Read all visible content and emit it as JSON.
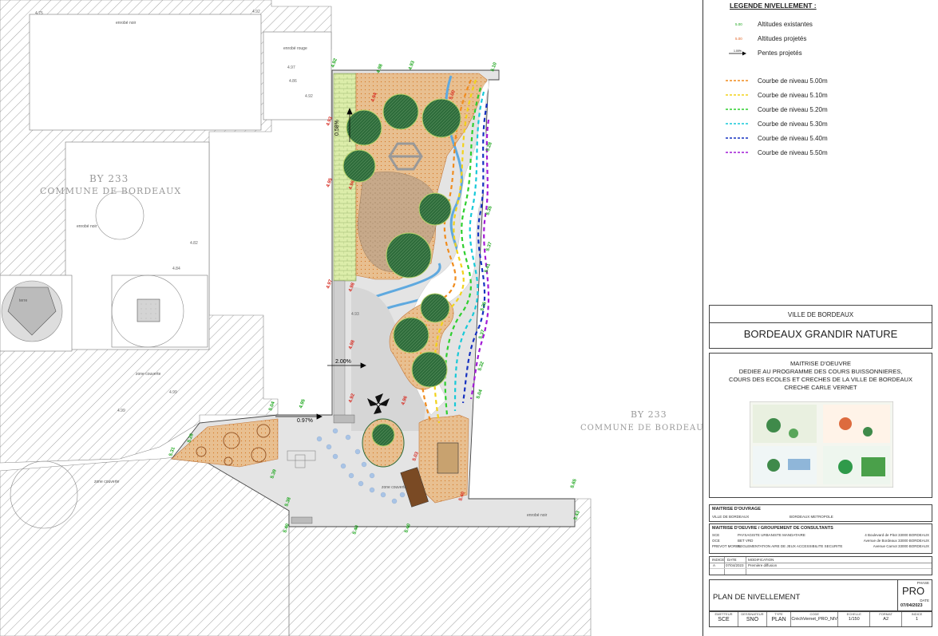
{
  "plan": {
    "parcel_left": {
      "line1": "BY 233",
      "line2": "COMMUNE DE BORDEAUX"
    },
    "parcel_right": {
      "line1": "BY 233",
      "line2": "COMMUNE DE BORDEAU"
    },
    "slopes": [
      "0.58%",
      "2.00%",
      "0.97%"
    ],
    "small_labels": [
      "terre",
      "zone couverte",
      "zone couverte",
      "zone couverte",
      "enrobé noir",
      "enrobé rouge",
      "enrobé noir",
      "enrobé noir"
    ],
    "altitudes_existing": [
      "4.92",
      "4.98",
      "4.93",
      "5.10",
      "5.04",
      "4.95",
      "5.31",
      "5.26",
      "5.39",
      "5.38",
      "5.40",
      "5.40",
      "5.40",
      "5.65",
      "5.43",
      "5.28",
      "5.35",
      "5.37",
      "5.41",
      "5.35",
      "5.37",
      "5.32",
      "5.04"
    ],
    "altitudes_projected": [
      "4.93",
      "4.95",
      "4.97",
      "4.98",
      "4.98",
      "4.94",
      "4.92",
      "4.96",
      "4.96",
      "5.00",
      "5.40",
      "5.03"
    ],
    "grey_labels": [
      "4.75",
      "4.92",
      "4.97",
      "4.86",
      "4.92",
      "4.82",
      "4.84",
      "4.99",
      "4.99",
      "4.93"
    ]
  },
  "legend": {
    "title": "LEGENDE NIVELLEMENT :",
    "items": [
      {
        "label": "Altitudes existantes",
        "symbol_text": "5.00",
        "color": "#1aa51a",
        "kind": "text"
      },
      {
        "label": "Altitudes projetés",
        "symbol_text": "5.00",
        "color": "#e06020",
        "kind": "text"
      },
      {
        "label": "Pentes projetés",
        "symbol_text": "1.00%",
        "color": "#000000",
        "kind": "arrow"
      },
      {
        "label": "Courbe de niveau 5.00m",
        "color": "#f08c1e",
        "kind": "dash"
      },
      {
        "label": "Courbe de niveau 5.10m",
        "color": "#f2d21a",
        "kind": "dash"
      },
      {
        "label": "Courbe de niveau 5.20m",
        "color": "#2fcf2f",
        "kind": "dash"
      },
      {
        "label": "Courbe de niveau 5.30m",
        "color": "#17c9d8",
        "kind": "dash"
      },
      {
        "label": "Courbe de niveau 5.40m",
        "color": "#1530c0",
        "kind": "dash"
      },
      {
        "label": "Courbe de niveau 5.50m",
        "color": "#a21ad6",
        "kind": "dash"
      }
    ]
  },
  "cartouche": {
    "city": "VILLE DE BORDEAUX",
    "project": "BORDEAUX GRANDIR NATURE",
    "moe_lines": [
      "MAITRISE D'OEUVRE",
      "DEDIEE AU PROGRAMME DES COURS BUISSONNIERES,",
      "COURS DES ECOLES ET CRECHES DE LA VILLE DE BORDEAUX",
      "CRECHE CARLE VERNET"
    ],
    "moa_title": "MAITRISE D'OUVRAGE",
    "moa_left": "VILLE DE BORDEAUX",
    "moa_right": "BORDEAUX METROPOLE",
    "group_title": "MAITRISE D'OEUVRE / GROUPEMENT DE CONSULTANTS",
    "consultants": [
      {
        "code": "SCE",
        "name": "PAYSAGISTE URBANISTE MANDATAIRE",
        "addr": "4 Boulevard de Pitot 33000 BORDEAUX"
      },
      {
        "code": "OCE",
        "name": "BET VRD",
        "addr": "Avenue de Bordeaux 33000 BORDEAUX"
      },
      {
        "code": "PREVOT MOREL",
        "name": "REGLEMENTATION AIRE DE JEUX ACCESSIBILITE SECURITE",
        "addr": "Avenue Carnot 33000 BORDEAUX"
      }
    ],
    "index_headers": [
      "INDICE",
      "DATE",
      "MODIFICATION"
    ],
    "index_rows": [
      [
        "A",
        "07/04/2023",
        "Première diffusion"
      ]
    ],
    "drawing_title": "PLAN DE NIVELLEMENT",
    "phase_label": "PHASE",
    "phase": "PRO",
    "date_label": "DATE",
    "date": "07/04/2023",
    "footer_headers": [
      "EMETTEUR",
      "DESSINATEUR",
      "TYPE",
      "CODE",
      "ECHELLE",
      "FORMAT",
      "INDICE"
    ],
    "footer_values": [
      "SCE",
      "SNO",
      "PLAN",
      "CrèchVernet_PRO_NIV",
      "1/150",
      "A2",
      "1"
    ]
  },
  "colors": {
    "hatch": "#8a8a8a",
    "green_strip": "#d5ea9a",
    "sand": "#e6b98a",
    "tree": "#2d6b3a",
    "path_blue": "#5fa9df",
    "grey_pavement": "#cfcfcf"
  }
}
